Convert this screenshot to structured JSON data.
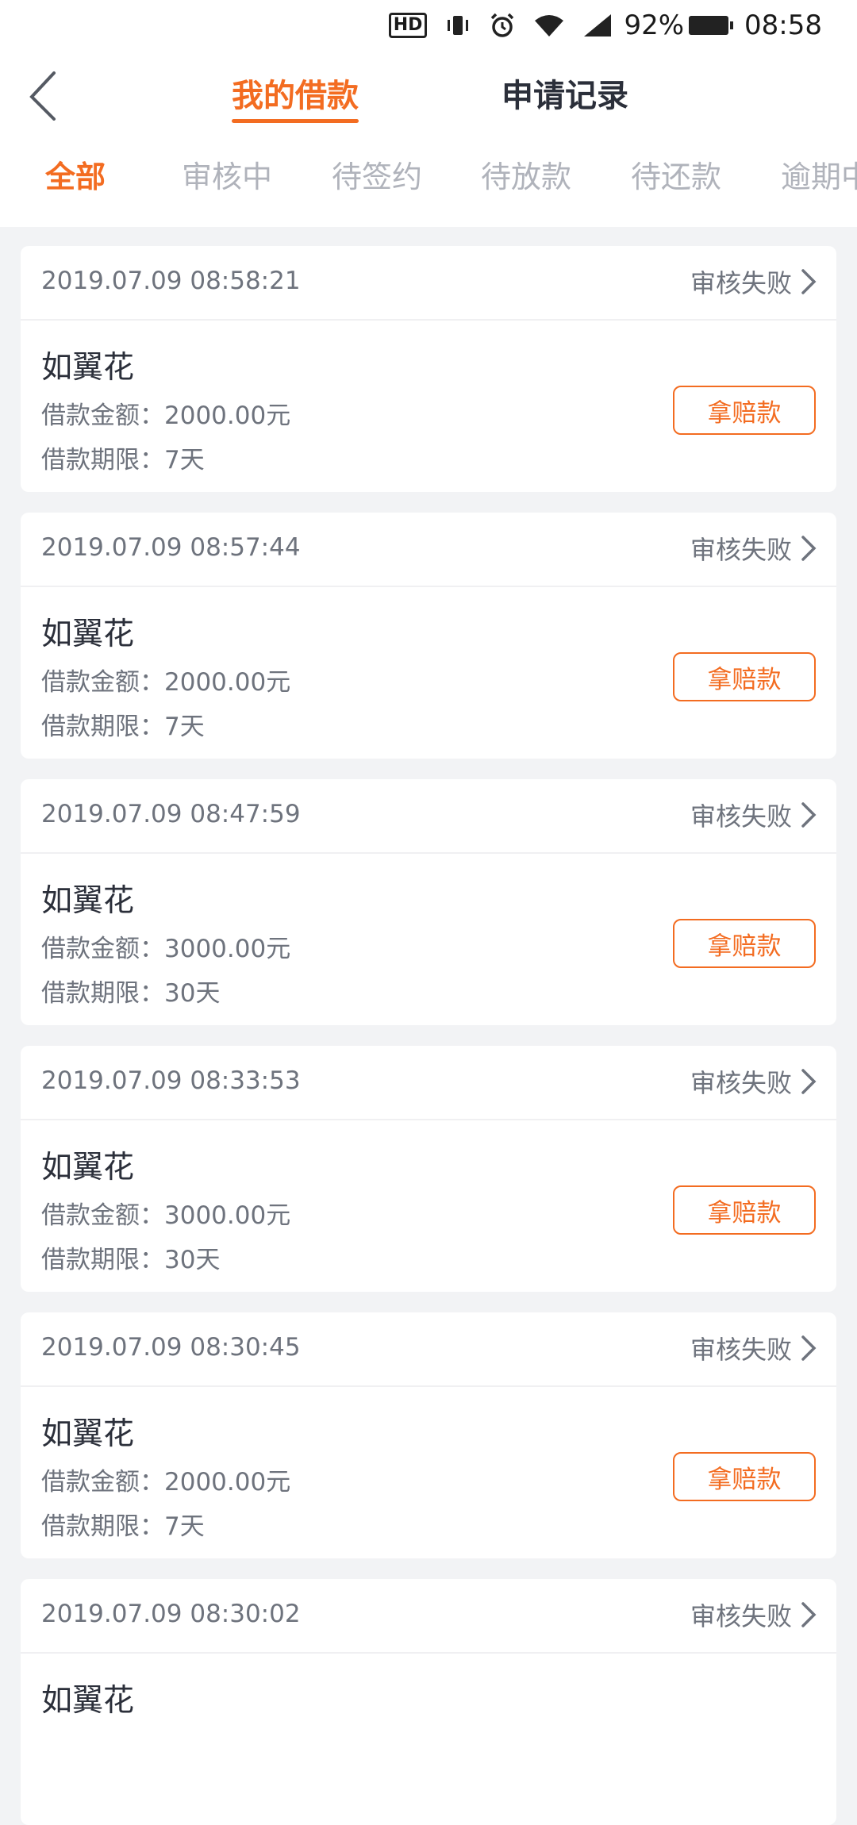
{
  "status_bar": {
    "hd": "HD",
    "battery": "92%",
    "time": "08:58"
  },
  "header": {
    "tabs": [
      {
        "label": "我的借款",
        "active": true
      },
      {
        "label": "申请记录",
        "active": false
      }
    ]
  },
  "filters": [
    {
      "label": "全部",
      "active": true
    },
    {
      "label": "审核中",
      "active": false
    },
    {
      "label": "待签约",
      "active": false
    },
    {
      "label": "待放款",
      "active": false
    },
    {
      "label": "待还款",
      "active": false
    },
    {
      "label": "逾期中",
      "active": false
    }
  ],
  "colors": {
    "accent": "#f36c21",
    "background": "#f2f3f5"
  },
  "loans": [
    {
      "time": "2019.07.09 08:58:21",
      "status": "审核失败",
      "product": "如翼花",
      "amount_text": "借款金额：2000.00元",
      "term_text": "借款期限：7天",
      "action": "拿赔款"
    },
    {
      "time": "2019.07.09 08:57:44",
      "status": "审核失败",
      "product": "如翼花",
      "amount_text": "借款金额：2000.00元",
      "term_text": "借款期限：7天",
      "action": "拿赔款"
    },
    {
      "time": "2019.07.09 08:47:59",
      "status": "审核失败",
      "product": "如翼花",
      "amount_text": "借款金额：3000.00元",
      "term_text": "借款期限：30天",
      "action": "拿赔款"
    },
    {
      "time": "2019.07.09 08:33:53",
      "status": "审核失败",
      "product": "如翼花",
      "amount_text": "借款金额：3000.00元",
      "term_text": "借款期限：30天",
      "action": "拿赔款"
    },
    {
      "time": "2019.07.09 08:30:45",
      "status": "审核失败",
      "product": "如翼花",
      "amount_text": "借款金额：2000.00元",
      "term_text": "借款期限：7天",
      "action": "拿赔款"
    },
    {
      "time": "2019.07.09 08:30:02",
      "status": "审核失败",
      "product": "如翼花",
      "amount_text": "",
      "term_text": "",
      "action": ""
    }
  ]
}
